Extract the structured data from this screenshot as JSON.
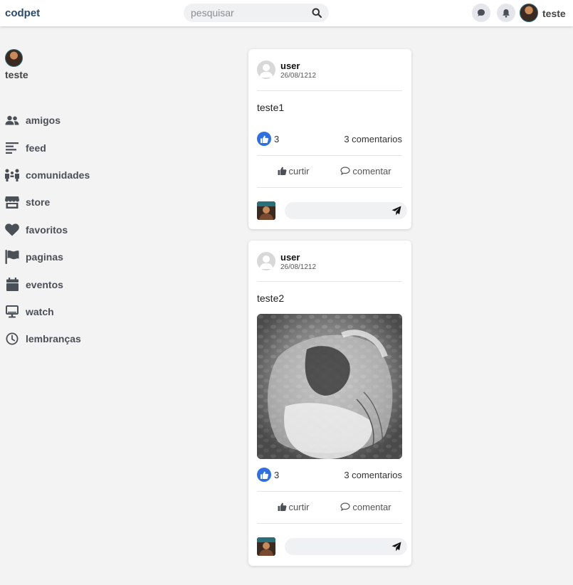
{
  "topbar": {
    "brand": "codpet",
    "search_placeholder": "pesquisar",
    "username": "teste"
  },
  "sidebar": {
    "username": "teste",
    "items": [
      {
        "label": "amigos",
        "icon": "people-icon"
      },
      {
        "label": "feed",
        "icon": "feed-lines-icon"
      },
      {
        "label": "comunidades",
        "icon": "groups-icon"
      },
      {
        "label": "store",
        "icon": "store-icon"
      },
      {
        "label": "favoritos",
        "icon": "heart-icon"
      },
      {
        "label": "paginas",
        "icon": "flag-icon"
      },
      {
        "label": "eventos",
        "icon": "calendar-icon"
      },
      {
        "label": "watch",
        "icon": "monitor-icon"
      },
      {
        "label": "lembranças",
        "icon": "clock-icon"
      }
    ]
  },
  "posts": [
    {
      "author": "user",
      "date": "26/08/1212",
      "text": "teste1",
      "likes": "3",
      "comments": "3 comentarios",
      "like_label": "curtir",
      "comment_label": "comentar",
      "has_image": false
    },
    {
      "author": "user",
      "date": "26/08/1212",
      "text": "teste2",
      "likes": "3",
      "comments": "3 comentarios",
      "like_label": "curtir",
      "comment_label": "comentar",
      "has_image": true
    }
  ],
  "colors": {
    "brand": "#2b4a6b",
    "like_blue": "#2f6fe0",
    "background": "#f3f3f3"
  }
}
